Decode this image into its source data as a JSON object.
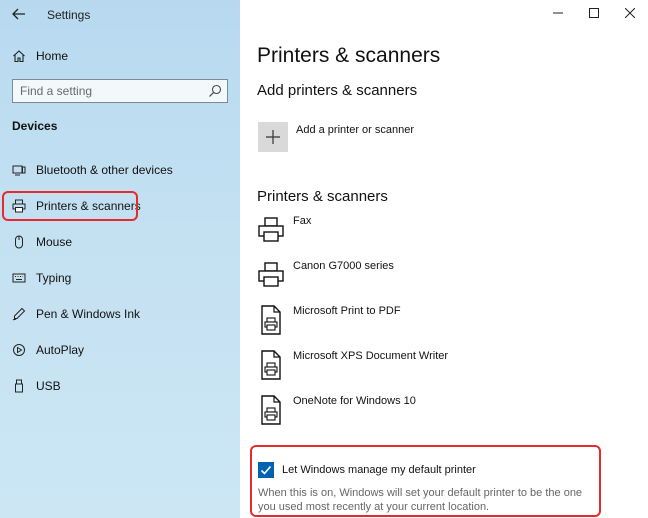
{
  "window": {
    "title": "Settings",
    "controls": {
      "minimize": "—",
      "maximize": "☐",
      "close": "✕"
    }
  },
  "sidebar": {
    "home_label": "Home",
    "search": {
      "placeholder": "Find a setting"
    },
    "section_heading": "Devices",
    "items": [
      {
        "label": "Bluetooth & other devices",
        "icon": "bluetooth-devices-icon"
      },
      {
        "label": "Printers & scanners",
        "icon": "printer-icon"
      },
      {
        "label": "Mouse",
        "icon": "mouse-icon"
      },
      {
        "label": "Typing",
        "icon": "keyboard-icon"
      },
      {
        "label": "Pen & Windows Ink",
        "icon": "pen-icon"
      },
      {
        "label": "AutoPlay",
        "icon": "autoplay-icon"
      },
      {
        "label": "USB",
        "icon": "usb-icon"
      }
    ]
  },
  "main": {
    "page_title": "Printers & scanners",
    "add_section": {
      "heading": "Add printers & scanners",
      "add_label": "Add a printer or scanner"
    },
    "list_section": {
      "heading": "Printers & scanners",
      "printers": [
        {
          "name": "Fax",
          "icon": "printer-icon"
        },
        {
          "name": "Canon G7000 series",
          "icon": "printer-icon"
        },
        {
          "name": "Microsoft Print to PDF",
          "icon": "document-printer-icon"
        },
        {
          "name": "Microsoft XPS Document Writer",
          "icon": "document-printer-icon"
        },
        {
          "name": "OneNote for Windows 10",
          "icon": "document-printer-icon"
        }
      ]
    },
    "default_printer": {
      "checked": true,
      "label": "Let Windows manage my default printer",
      "description": "When this is on, Windows will set your default printer to be the one you used most recently at your current location."
    }
  },
  "colors": {
    "accent": "#0063b1",
    "highlight": "#e52b2b",
    "sidebar_bg": "#c4e1f2"
  }
}
